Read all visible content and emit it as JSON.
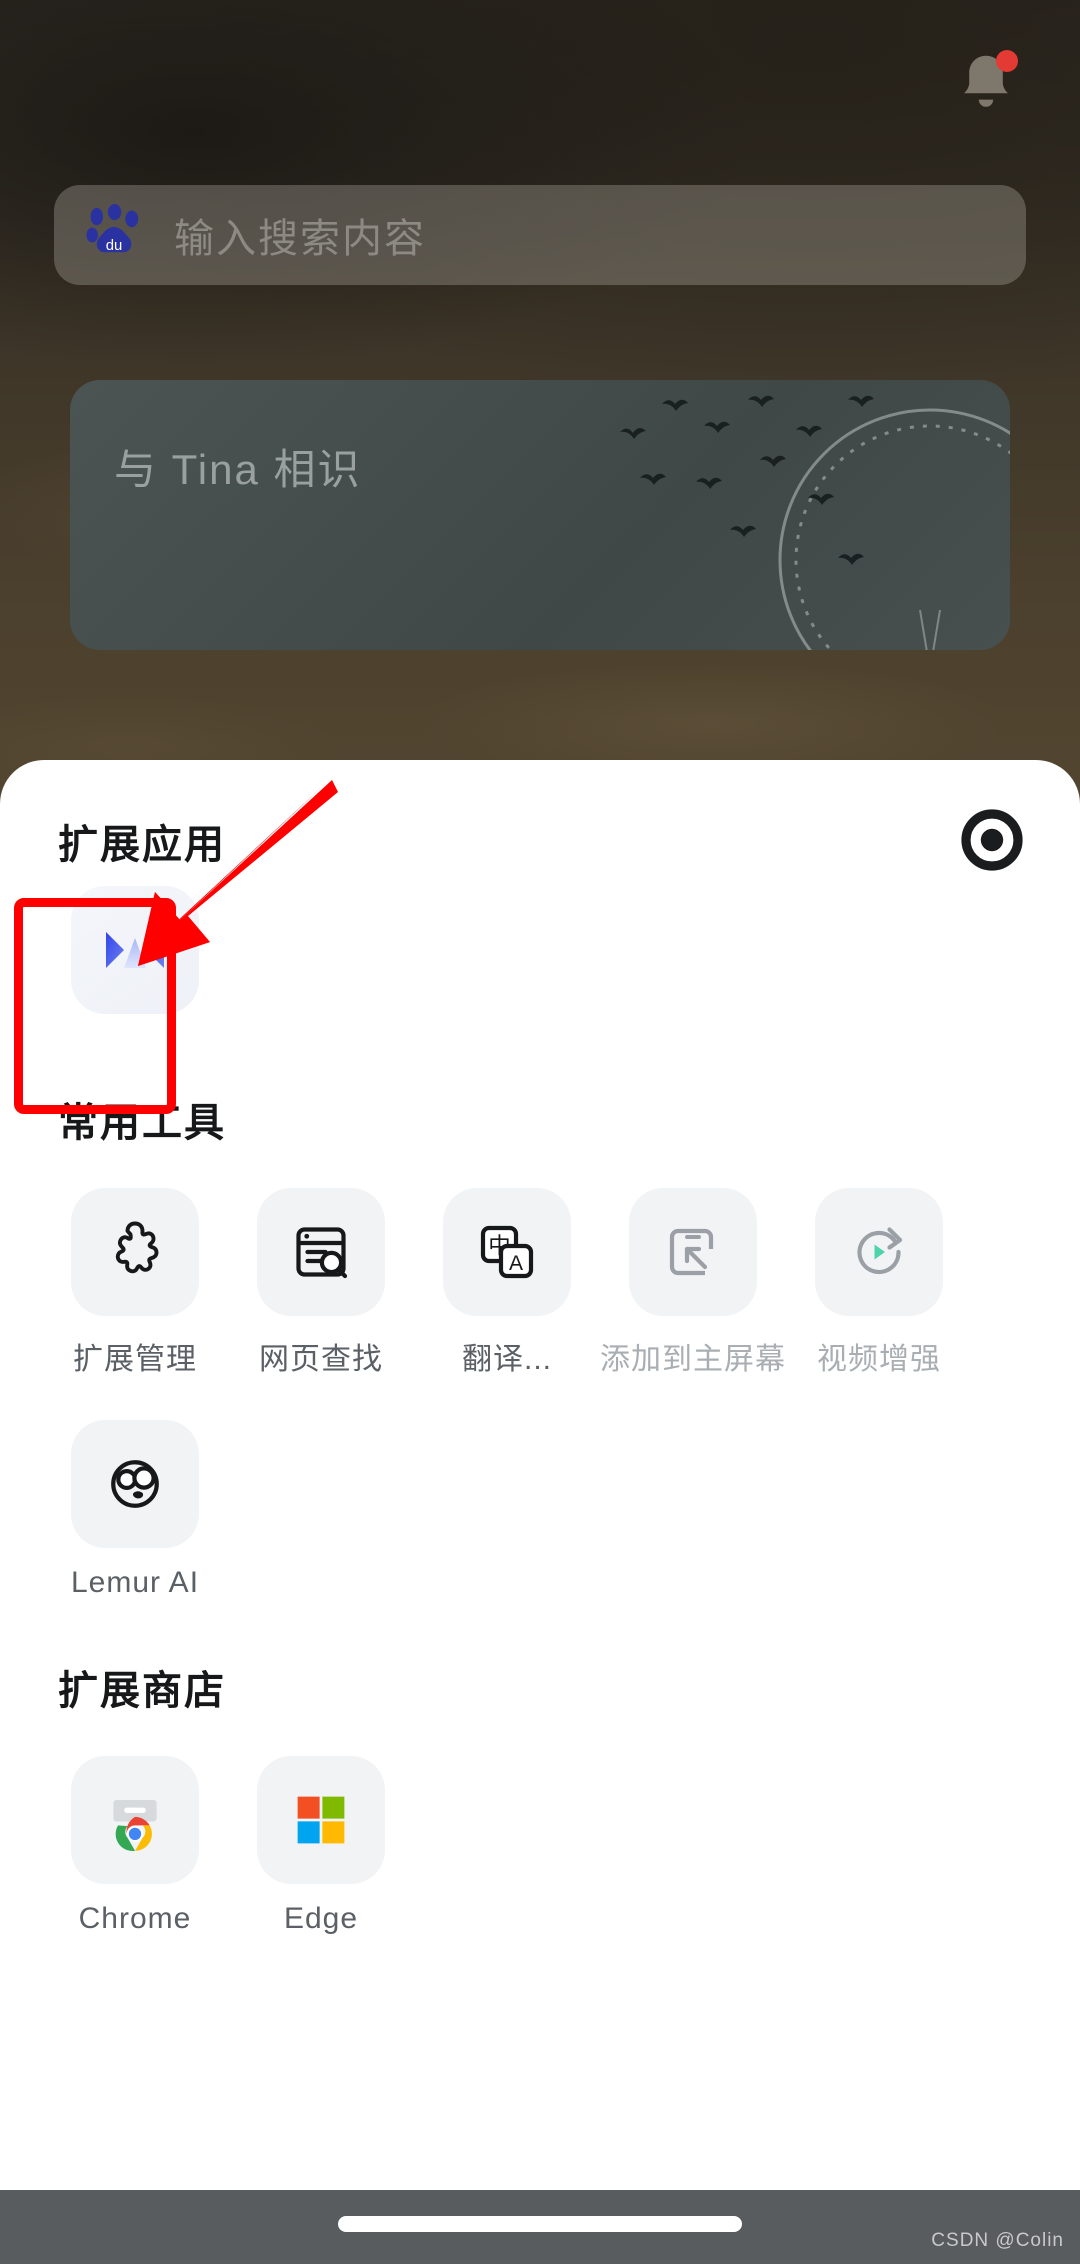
{
  "wallpaper": {
    "bell_icon": "bell-icon",
    "notification_dot": true
  },
  "search": {
    "engine_icon": "baidu-paw-icon",
    "placeholder": "输入搜索内容",
    "value": ""
  },
  "promo_card": {
    "title": "与 Tina 相识",
    "art": "birds-and-compass-illustration"
  },
  "sheet": {
    "title": "扩展应用",
    "record_icon": "record-target-icon",
    "extension_apps": [
      {
        "label": "",
        "icon": "blue-bowtie-extension-icon"
      }
    ],
    "sections": [
      {
        "title": "常用工具",
        "items": [
          {
            "label": "扩展管理",
            "icon": "puzzle-piece-icon",
            "dim": false
          },
          {
            "label": "网页查找",
            "icon": "page-search-icon",
            "dim": false
          },
          {
            "label": "翻译...",
            "icon": "translate-icon",
            "dim": false
          },
          {
            "label": "添加到主屏幕",
            "icon": "add-to-homescreen-icon",
            "dim": true
          },
          {
            "label": "视频增强",
            "icon": "video-boost-icon",
            "dim": true
          },
          {
            "label": "Lemur AI",
            "icon": "lemur-face-icon",
            "dim": false
          }
        ]
      },
      {
        "title": "扩展商店",
        "items": [
          {
            "label": "Chrome",
            "icon": "chrome-web-store-icon",
            "dim": false
          },
          {
            "label": "Edge",
            "icon": "microsoft-store-icon",
            "dim": false
          }
        ]
      }
    ]
  },
  "annotations": {
    "highlight_box_color": "#ff0000",
    "arrow_color": "#ff0000"
  },
  "system": {
    "home_indicator": "home-indicator",
    "watermark": "CSDN @Colin"
  },
  "colors": {
    "accent_blue": "#3a4fe0",
    "tile_bg": "#f1f3f5",
    "text_primary": "#17181a",
    "text_secondary": "#5b6066",
    "text_dim": "#a9aeb3",
    "annotation_red": "#ff0000",
    "gesture_bar": "#585c5e"
  }
}
